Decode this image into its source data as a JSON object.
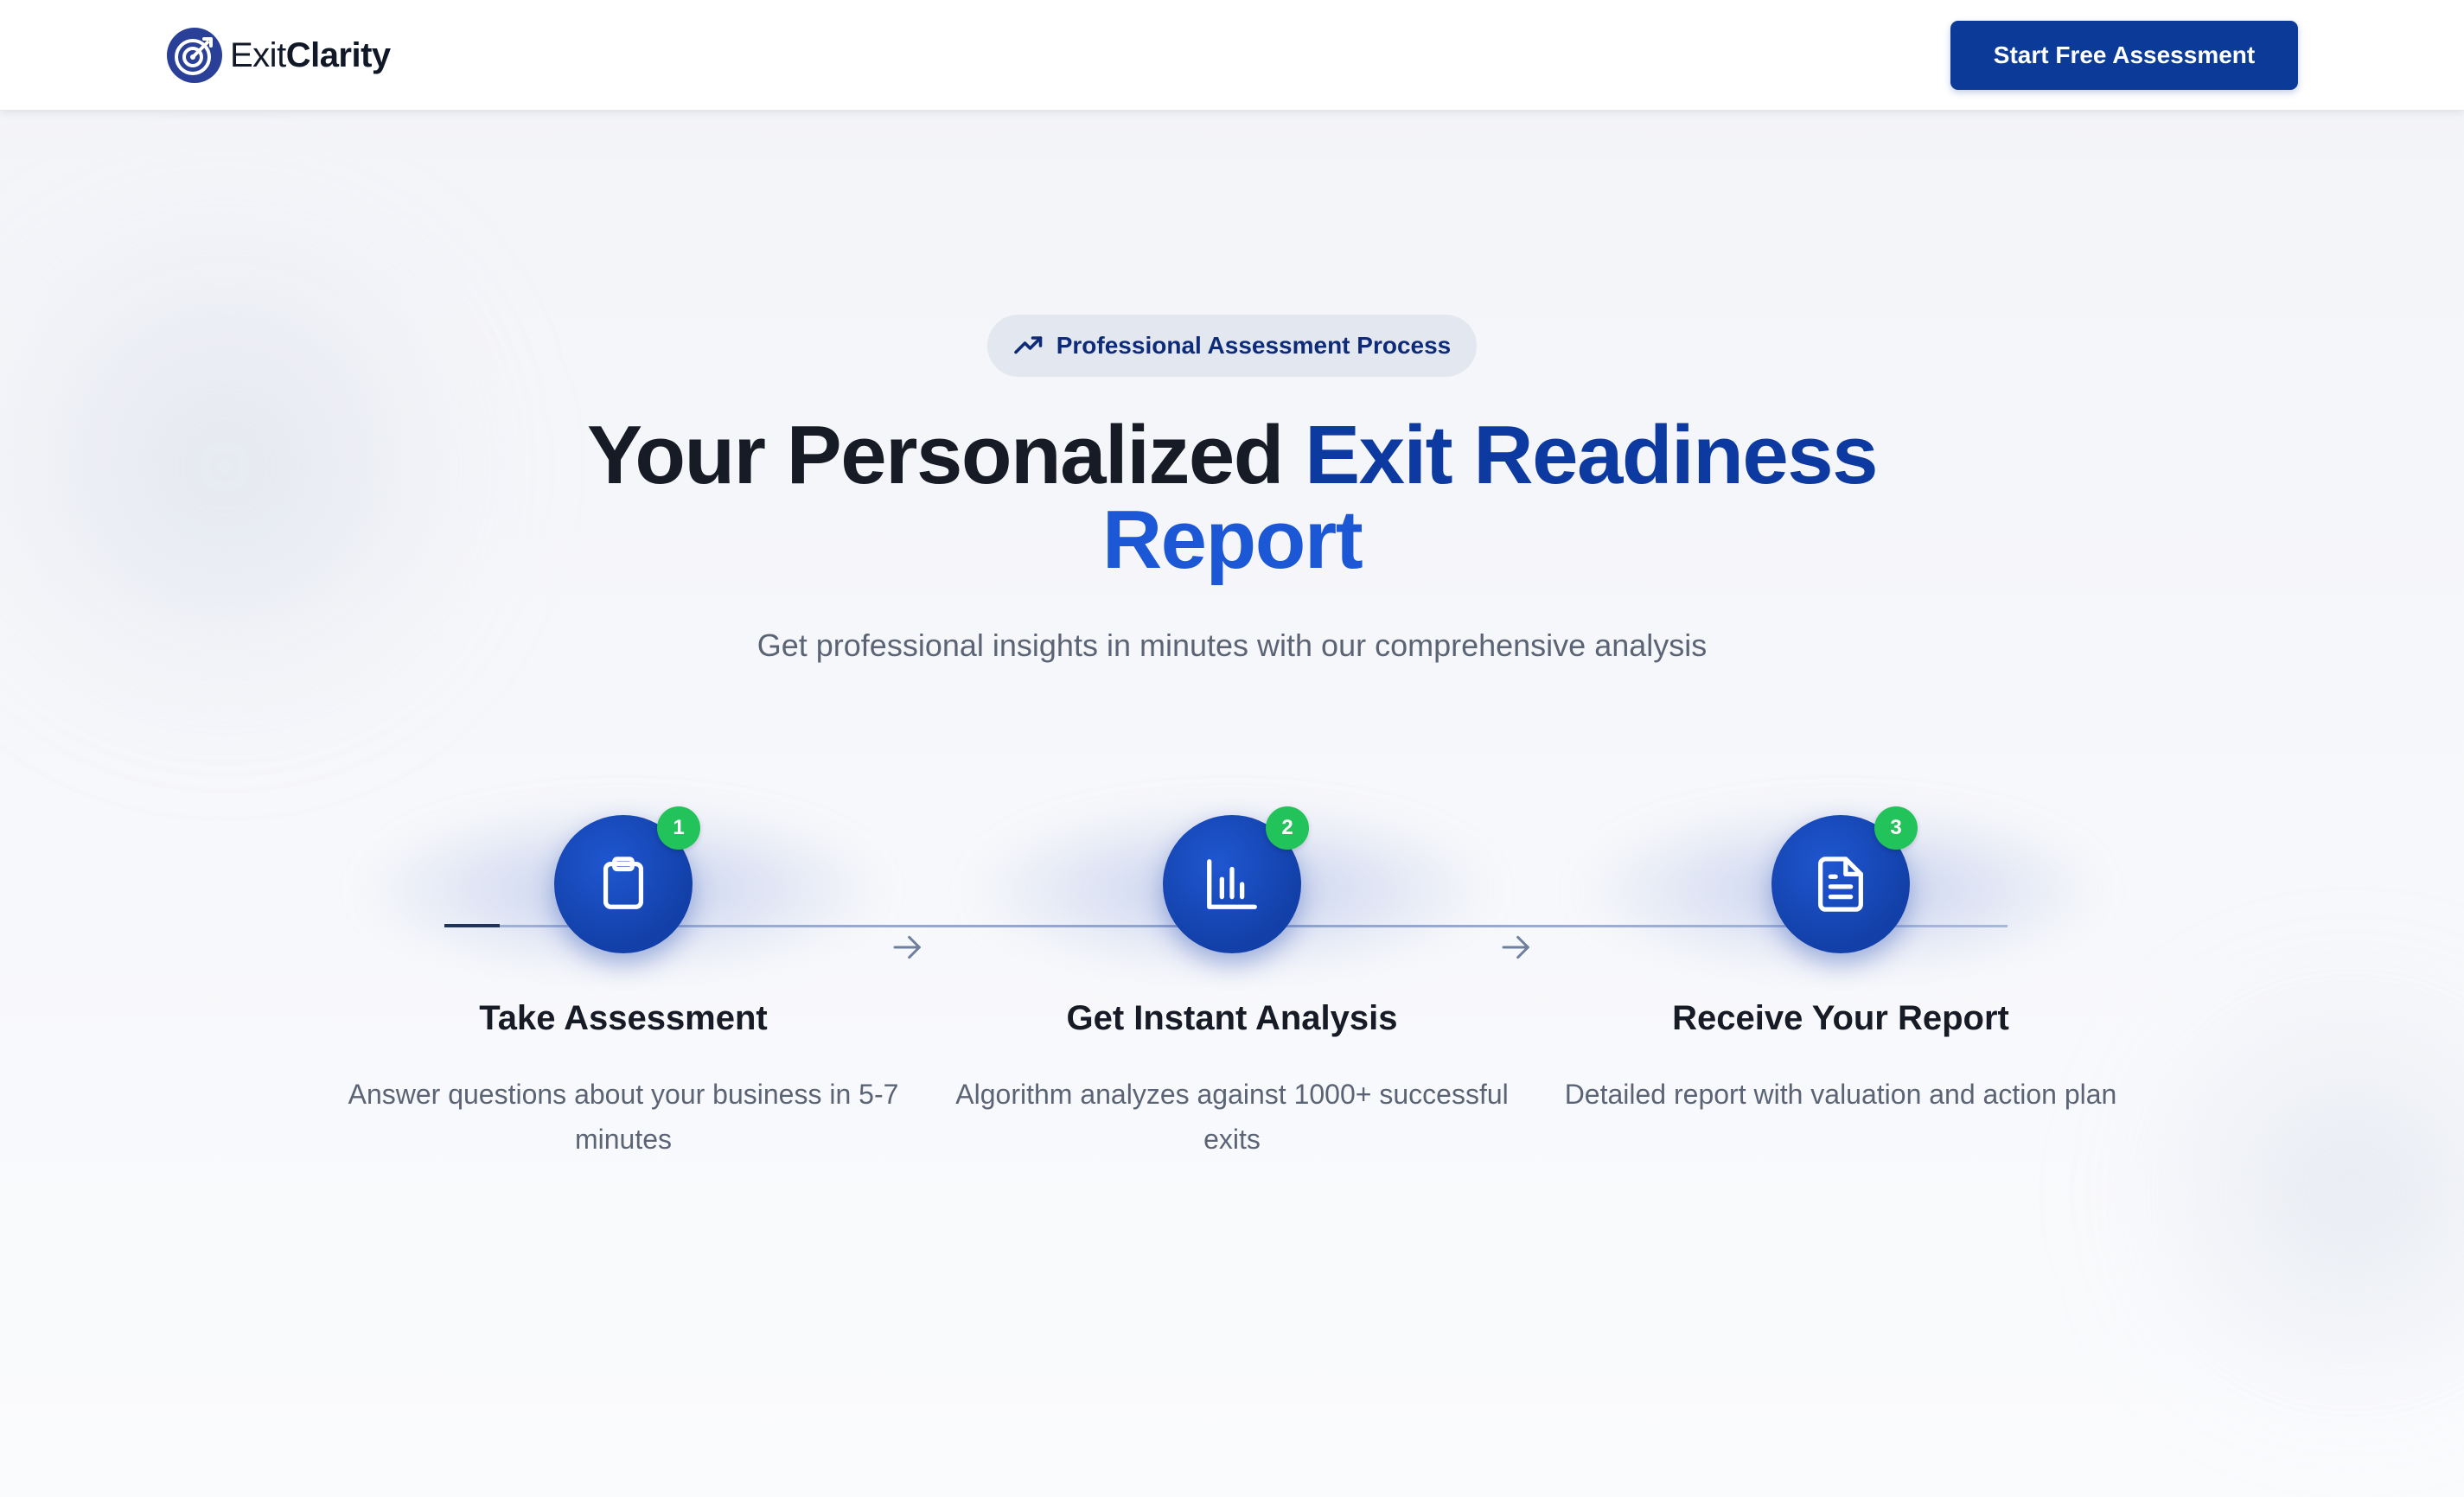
{
  "header": {
    "logo_text_light": "Exit",
    "logo_text_bold": "Clarity",
    "logo_icon": "target-icon",
    "cta_label": "Start Free Assessment"
  },
  "hero": {
    "badge_label": "Professional Assessment Process",
    "badge_icon": "trending-up-icon",
    "headline_dark": "Your Personalized ",
    "headline_accent_1": "Exit Readiness",
    "headline_accent_2": "Report",
    "subtitle": "Get professional insights in minutes with our comprehensive analysis"
  },
  "steps": [
    {
      "number": "1",
      "icon": "clipboard-icon",
      "title": "Take Assessment",
      "description": "Answer questions about your business in 5-7 minutes"
    },
    {
      "number": "2",
      "icon": "bar-chart-icon",
      "title": "Get Instant Analysis",
      "description": "Algorithm analyzes against 1000+ successful exits"
    },
    {
      "number": "3",
      "icon": "document-icon",
      "title": "Receive Your Report",
      "description": "Detailed report with valuation and action plan"
    }
  ],
  "colors": {
    "brand_navy": "#0b3a99",
    "accent_blue": "#1c58d6",
    "success_green": "#22c35a",
    "text_dark": "#161b26",
    "text_muted": "#5b6475"
  }
}
